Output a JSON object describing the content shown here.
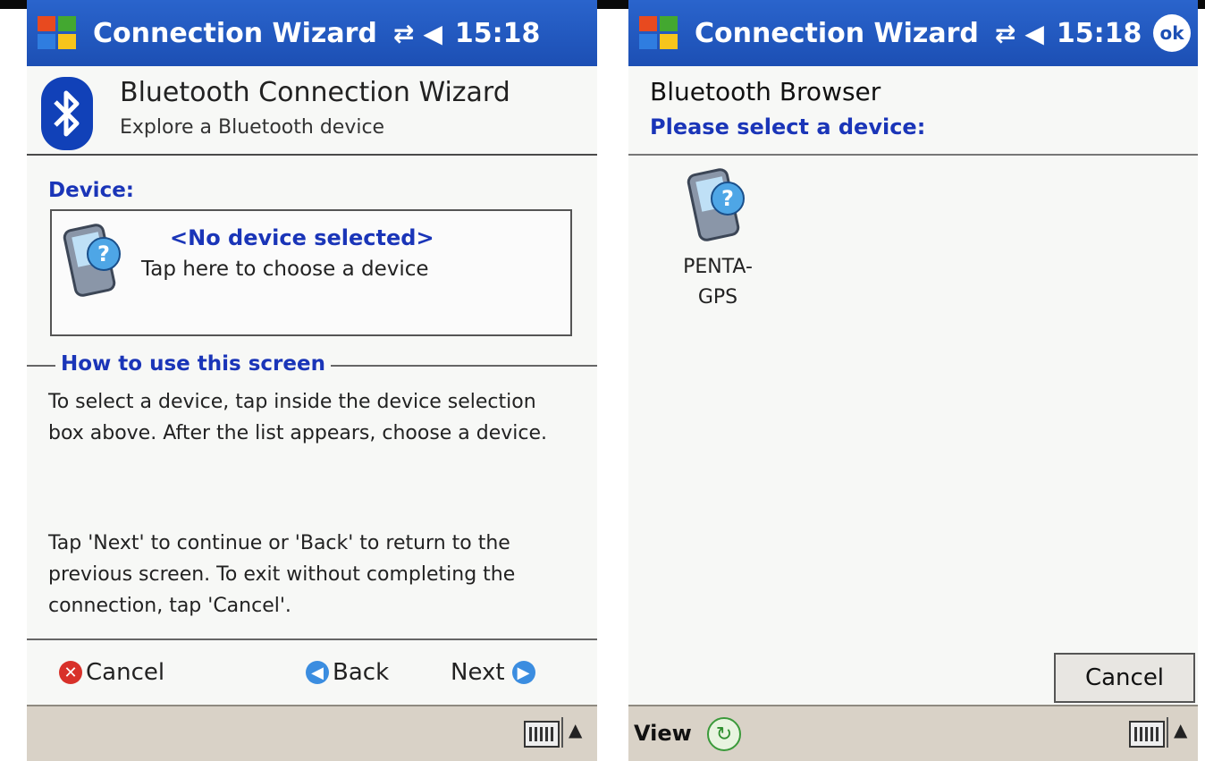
{
  "left": {
    "titlebar": {
      "app": "Connection Wizard",
      "icons": [
        "connectivity-icon",
        "speaker-icon"
      ],
      "time": "15:18"
    },
    "header": {
      "title": "Bluetooth Connection Wizard",
      "subtitle": "Explore a Bluetooth device"
    },
    "device_label": "Device:",
    "device_box": {
      "name": "<No device selected>",
      "hint": "Tap here to choose a device"
    },
    "howto_label": "How to use this screen",
    "para1": "To select a device, tap inside the device selection box above. After the list appears, choose a device.",
    "para2": "Tap 'Next' to continue or 'Back' to return to the previous screen. To exit without completing the connection, tap 'Cancel'.",
    "buttons": {
      "cancel": "Cancel",
      "back": "Back",
      "next": "Next"
    }
  },
  "right": {
    "titlebar": {
      "app": "Connection Wizard",
      "time": "15:18",
      "ok": "ok"
    },
    "title": "Bluetooth Browser",
    "subtitle": "Please select a device:",
    "devices": [
      {
        "label_line1": "PENTA-",
        "label_line2": "GPS"
      }
    ],
    "cancel": "Cancel",
    "view": "View"
  },
  "colors": {
    "titlebar": "#1c4fb4",
    "accent_text": "#1a35b8",
    "menubar": "#d9d2c7"
  }
}
